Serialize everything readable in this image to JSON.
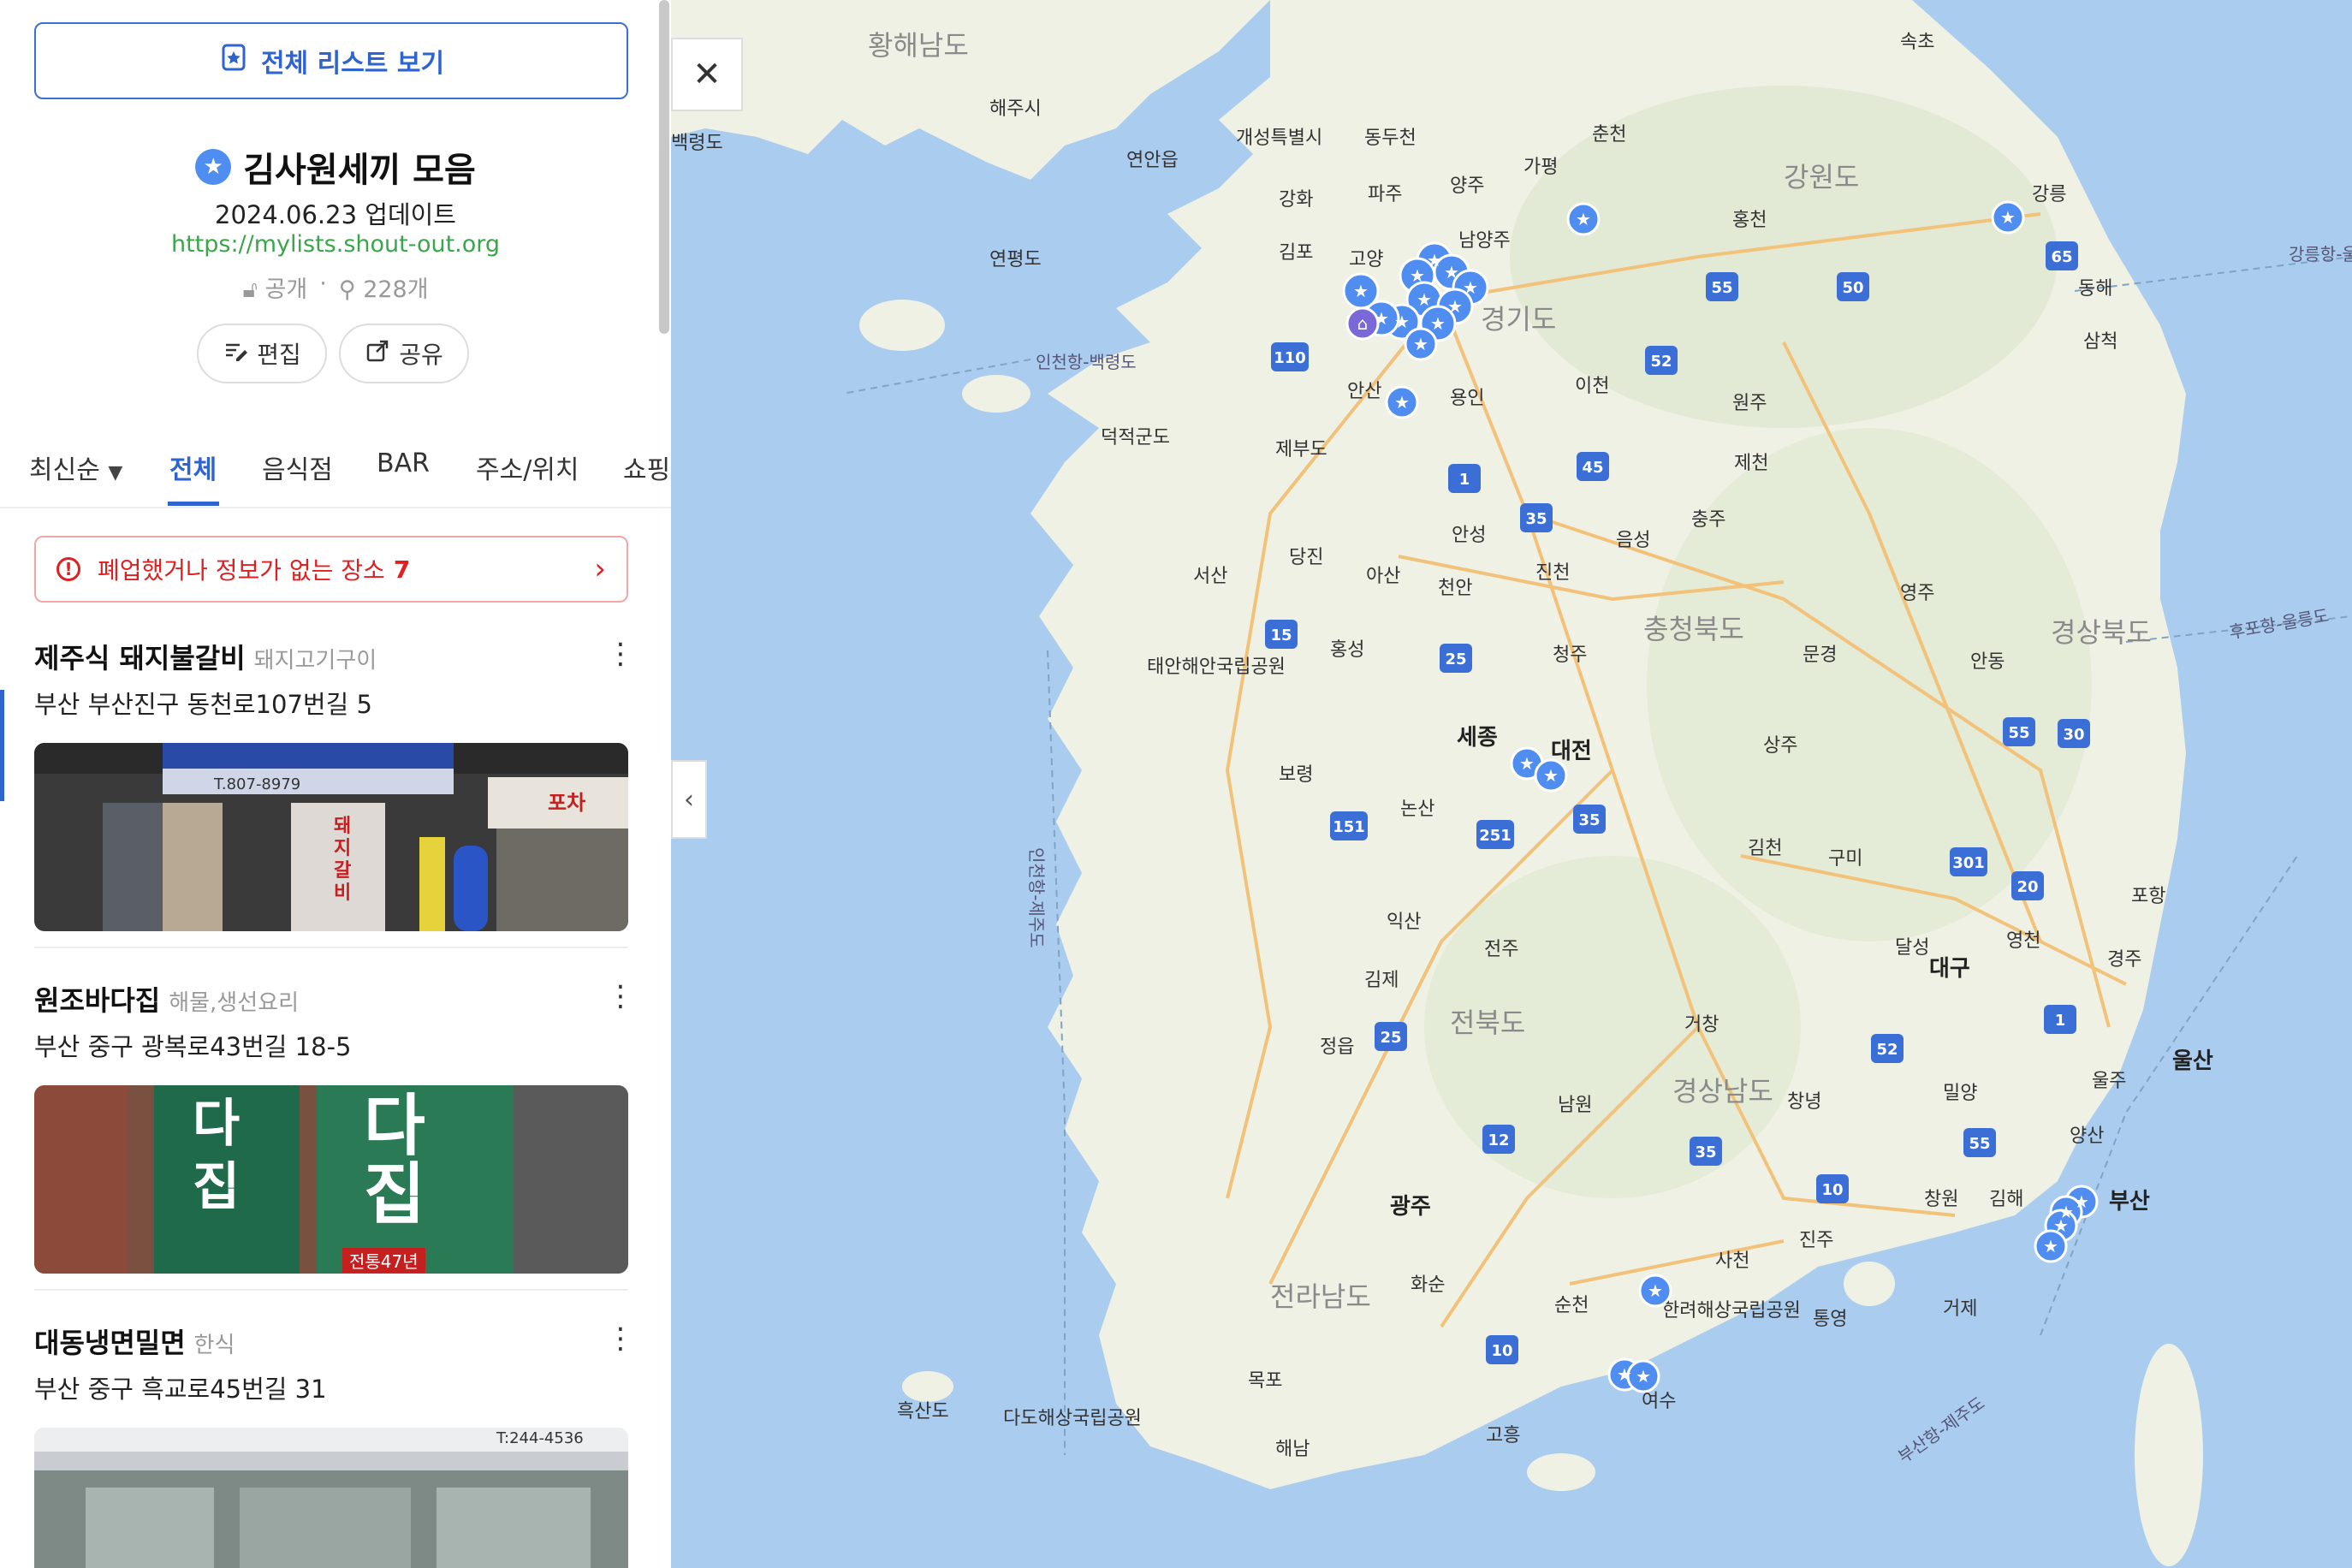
{
  "sidebar": {
    "view_all_label": "전체 리스트 보기",
    "title": "김사원세끼 모음",
    "updated": "2024.06.23 업데이트",
    "url": "https://mylists.shout-out.org",
    "visibility": "공개",
    "place_count": "228개",
    "edit_label": "편집",
    "share_label": "공유",
    "sort_label": "최신순",
    "tabs": [
      "전체",
      "음식점",
      "BAR",
      "주소/위치",
      "쇼핑"
    ],
    "alert_text": "폐업했거나 정보가 없는 장소",
    "alert_count": "7",
    "places": [
      {
        "name": "제주식 돼지불갈비",
        "category": "돼지고기구이",
        "address": "부산 부산진구 동천로107번길 5",
        "sign1": "T.807-8979",
        "sign2": "돼지갈비",
        "sign3": "포차"
      },
      {
        "name": "원조바다집",
        "category": "해물,생선요리",
        "address": "부산 중구 광복로43번길 18-5",
        "sign1": "다집",
        "sign2": "다집",
        "sign3": "전통47년"
      },
      {
        "name": "대동냉면밀면",
        "category": "한식",
        "address": "부산 중구 흑교로45번길 31",
        "sign1": "T:244-4536"
      }
    ]
  },
  "map": {
    "close_icon": "close-icon",
    "collapse_icon": "chevron-left-icon",
    "regions": [
      "황해남도",
      "강원도",
      "경기도",
      "충청북도",
      "경상북도",
      "전북도",
      "경상남도",
      "전라남도"
    ],
    "cities": [
      "속초",
      "해주시",
      "개성특별시",
      "동두천",
      "춘천",
      "백령도",
      "연안읍",
      "가평",
      "강화",
      "파주",
      "양주",
      "강릉",
      "김포",
      "고양",
      "남양주",
      "홍천",
      "연평도",
      "동해",
      "인천항-백령도",
      "안산",
      "용인",
      "이천",
      "원주",
      "삼척",
      "덕적군도",
      "제부도",
      "제천",
      "안성",
      "음성",
      "충주",
      "당진",
      "서산",
      "아산",
      "천안",
      "진천",
      "영주",
      "홍성",
      "청주",
      "문경",
      "안동",
      "태안해안국립공원",
      "세종",
      "대전",
      "상주",
      "보령",
      "논산",
      "김천",
      "구미",
      "포항",
      "익산",
      "전주",
      "달성",
      "대구",
      "영천",
      "경주",
      "김제",
      "거창",
      "울산",
      "정읍",
      "남원",
      "창녕",
      "밀양",
      "울주",
      "양산",
      "부산",
      "광주",
      "김해",
      "창원",
      "진주",
      "사천",
      "순천",
      "화순",
      "한려해상국립공원",
      "통영",
      "거제",
      "여수",
      "목포",
      "흑산도",
      "다도해상국립공원",
      "고흥",
      "해남",
      "인천항-제주도",
      "부산항-제주도",
      "후포항-울릉도",
      "강릉항-울릉도"
    ],
    "highways": [
      "55",
      "50",
      "65",
      "110",
      "52",
      "1",
      "45",
      "35",
      "15",
      "25",
      "151",
      "251",
      "30",
      "301",
      "20",
      "12",
      "10"
    ],
    "colors": {
      "sea": "#aacdef",
      "land": "#eef1e4",
      "road": "#f2c27a",
      "marker": "#4f8ef0"
    }
  }
}
